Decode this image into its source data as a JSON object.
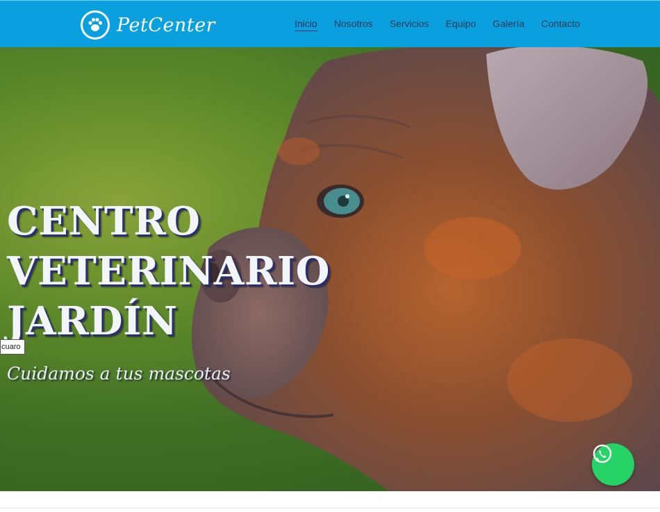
{
  "brand": {
    "name": "PetCenter",
    "logo_icon": "paw-icon",
    "color": "#0a9fdf"
  },
  "nav": {
    "items": [
      {
        "label": "Inicio",
        "active": true
      },
      {
        "label": "Nosotros"
      },
      {
        "label": "Servicios"
      },
      {
        "label": "Equipo"
      },
      {
        "label": "Galería"
      },
      {
        "label": "Contacto"
      }
    ]
  },
  "hero": {
    "title_line1": "CENTRO",
    "title_line2": "VETERINARIO",
    "title_line3": "JARDÍN",
    "subtitle": "Cuidamos a tus mascotas",
    "image_subject": "bulldog-photo"
  },
  "tooltip": {
    "text": "cuaro"
  },
  "whatsapp": {
    "icon": "whatsapp-icon",
    "color": "#25d366"
  }
}
